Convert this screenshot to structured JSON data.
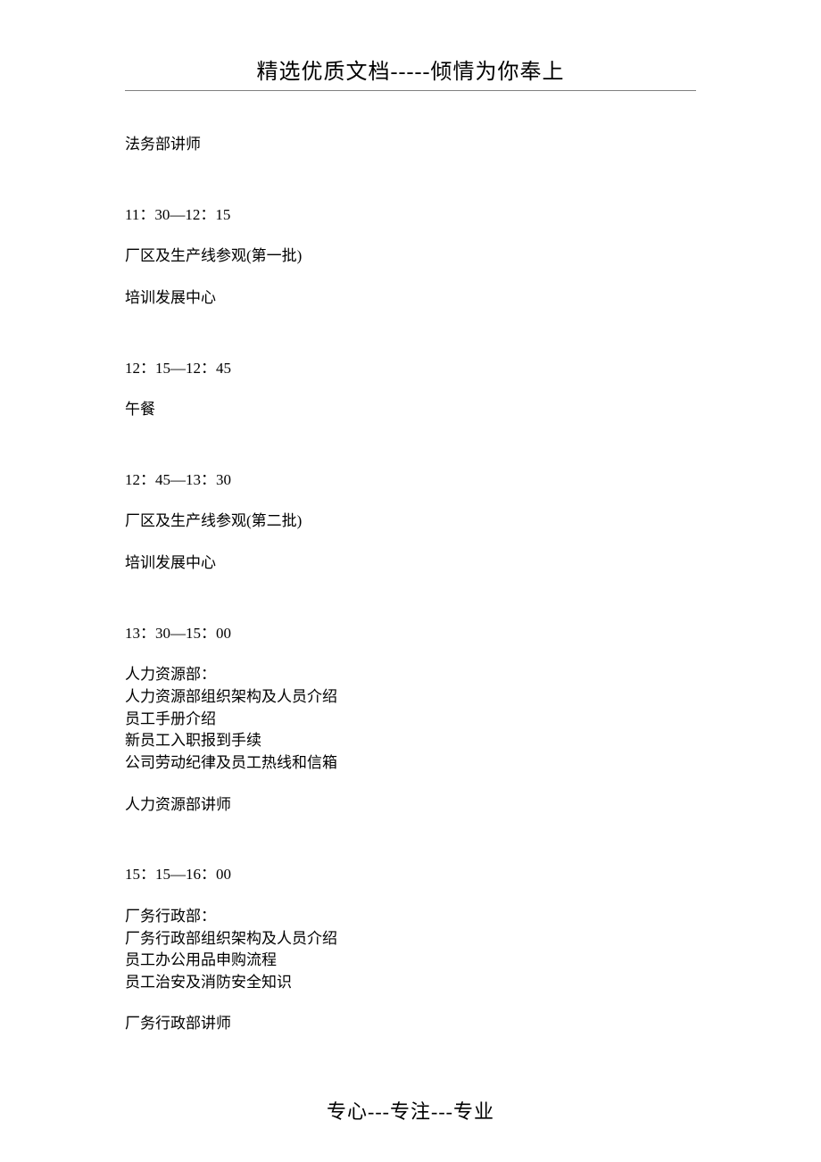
{
  "header": "精选优质文档-----倾情为你奉上",
  "footer": "专心---专注---专业",
  "sections": {
    "s0": {
      "presenter": "法务部讲师"
    },
    "s1": {
      "time": "11：30—12：15",
      "title": "厂区及生产线参观(第一批)",
      "presenter": "培训发展中心"
    },
    "s2": {
      "time": "12：15—12：45",
      "title": "午餐"
    },
    "s3": {
      "time": "12：45—13：30",
      "title": "厂区及生产线参观(第二批)",
      "presenter": "培训发展中心"
    },
    "s4": {
      "time": "13：30—15：00",
      "dept": "人力资源部：",
      "l1": "人力资源部组织架构及人员介绍",
      "l2": "员工手册介绍",
      "l3": "新员工入职报到手续",
      "l4": "公司劳动纪律及员工热线和信箱",
      "presenter": "人力资源部讲师"
    },
    "s5": {
      "time": "15：15—16：00",
      "dept": "厂务行政部：",
      "l1": "厂务行政部组织架构及人员介绍",
      "l2": "员工办公用品申购流程",
      "l3": "员工治安及消防安全知识",
      "presenter": "厂务行政部讲师"
    }
  }
}
